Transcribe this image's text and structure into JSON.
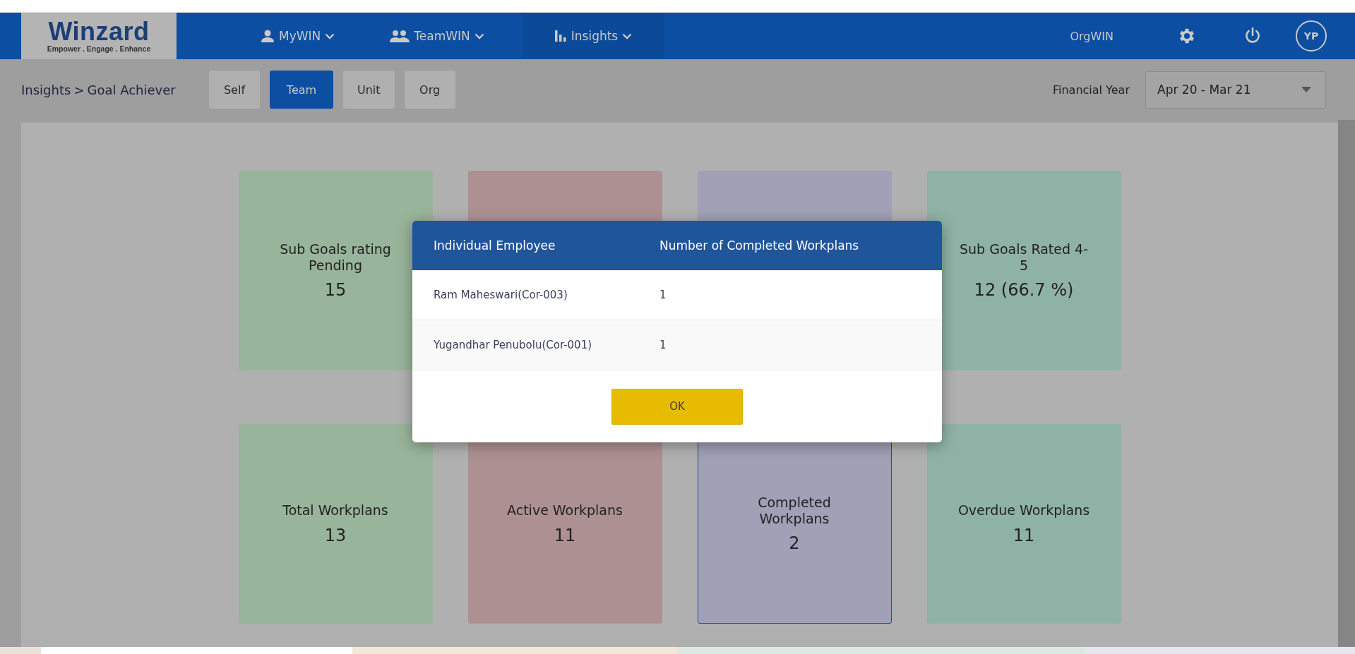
{
  "logo": {
    "name": "Winzard",
    "tagline": "Empower . Engage . Enhance"
  },
  "nav": [
    {
      "label": "MyWIN",
      "selected": false
    },
    {
      "label": "TeamWIN",
      "selected": false
    },
    {
      "label": "Insights",
      "selected": true
    }
  ],
  "header_right": {
    "org_link": "OrgWIN",
    "avatar": "YP"
  },
  "breadcrumb": {
    "section": "Insights",
    "separator": ">",
    "page": "Goal Achiever"
  },
  "scope_tabs": [
    {
      "label": "Self",
      "selected": false
    },
    {
      "label": "Team",
      "selected": true
    },
    {
      "label": "Unit",
      "selected": false
    },
    {
      "label": "Org",
      "selected": false
    }
  ],
  "financial_year": {
    "label": "Financial Year",
    "value": "Apr 20 - Mar 21"
  },
  "cards": [
    {
      "title": "Sub Goals rating Pending",
      "value": "15",
      "color": "#98b49a",
      "selected": false
    },
    {
      "color": "#ad9192",
      "selected": false
    },
    {
      "color": "#a0a0b6",
      "selected": false
    },
    {
      "title": "Sub Goals Rated 4-5",
      "value": "12 (66.7 %)",
      "color": "#8fb2a6",
      "selected": false
    },
    {
      "title": "Total Workplans",
      "value": "13",
      "color": "#98b49a",
      "selected": false
    },
    {
      "title": "Active Workplans",
      "value": "11",
      "color": "#ad9192",
      "selected": false
    },
    {
      "title": "Completed Workplans",
      "value": "2",
      "color": "#a0a0b6",
      "selected": true
    },
    {
      "title": "Overdue Workplans",
      "value": "11",
      "color": "#8fb2a6",
      "selected": false
    }
  ],
  "dialog": {
    "columns": [
      "Individual Employee",
      "Number of Completed Workplans"
    ],
    "rows": [
      [
        "Ram Maheswari(Cor-003)",
        "1"
      ],
      [
        "Yugandhar Penubolu(Cor-001)",
        "1"
      ]
    ],
    "button": "OK"
  }
}
